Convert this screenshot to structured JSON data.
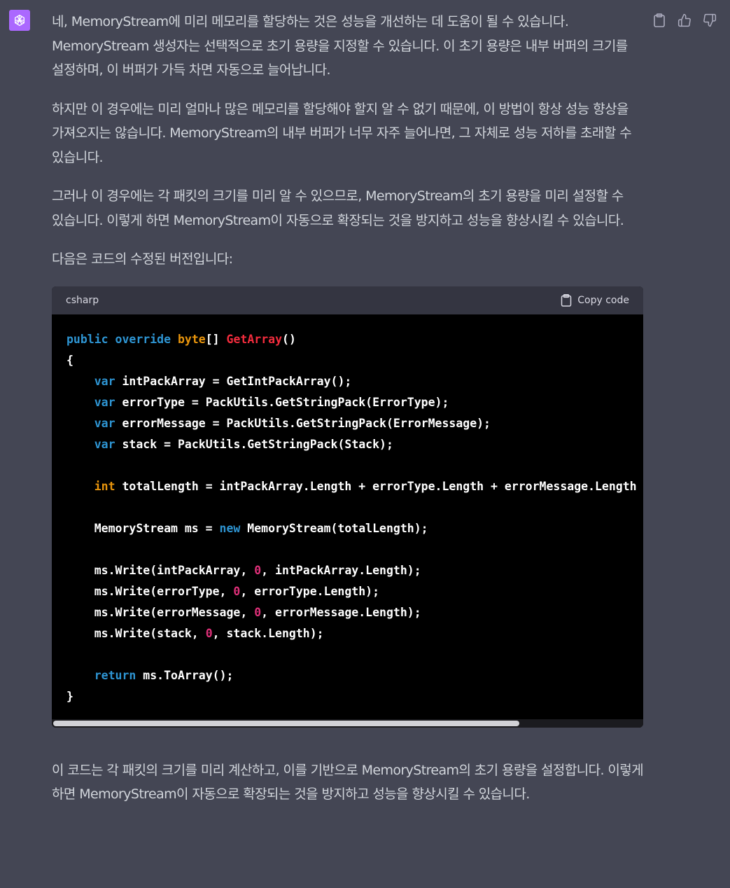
{
  "message": {
    "paragraphs": [
      "네, MemoryStream에 미리 메모리를 할당하는 것은 성능을 개선하는 데 도움이 될 수 있습니다. MemoryStream 생성자는 선택적으로 초기 용량을 지정할 수 있습니다. 이 초기 용량은 내부 버퍼의 크기를 설정하며, 이 버퍼가 가득 차면 자동으로 늘어납니다.",
      "하지만 이 경우에는 미리 얼마나 많은 메모리를 할당해야 할지 알 수 없기 때문에, 이 방법이 항상 성능 향상을 가져오지는 않습니다. MemoryStream의 내부 버퍼가 너무 자주 늘어나면, 그 자체로 성능 저하를 초래할 수 있습니다.",
      "그러나 이 경우에는 각 패킷의 크기를 미리 알 수 있으므로, MemoryStream의 초기 용량을 미리 설정할 수 있습니다. 이렇게 하면 MemoryStream이 자동으로 확장되는 것을 방지하고 성능을 향상시킬 수 있습니다.",
      "다음은 코드의 수정된 버전입니다:"
    ],
    "after": "이 코드는 각 패킷의 크기를 미리 계산하고, 이를 기반으로 MemoryStream의 초기 용량을 설정합니다. 이렇게 하면 MemoryStream이 자동으로 확장되는 것을 방지하고 성능을 향상시킬 수 있습니다."
  },
  "code": {
    "language": "csharp",
    "copy_label": "Copy code",
    "lines": [
      [
        {
          "t": "public",
          "c": "kw"
        },
        {
          "t": " "
        },
        {
          "t": "override",
          "c": "kw"
        },
        {
          "t": " "
        },
        {
          "t": "byte",
          "c": "ct"
        },
        {
          "t": "[] "
        },
        {
          "t": "GetArray",
          "c": "ty"
        },
        {
          "t": "()"
        }
      ],
      [
        {
          "t": "{"
        }
      ],
      [
        {
          "t": "    "
        },
        {
          "t": "var",
          "c": "kw"
        },
        {
          "t": " intPackArray = GetIntPackArray();"
        }
      ],
      [
        {
          "t": "    "
        },
        {
          "t": "var",
          "c": "kw"
        },
        {
          "t": " errorType = PackUtils.GetStringPack(ErrorType);"
        }
      ],
      [
        {
          "t": "    "
        },
        {
          "t": "var",
          "c": "kw"
        },
        {
          "t": " errorMessage = PackUtils.GetStringPack(ErrorMessage);"
        }
      ],
      [
        {
          "t": "    "
        },
        {
          "t": "var",
          "c": "kw"
        },
        {
          "t": " stack = PackUtils.GetStringPack(Stack);"
        }
      ],
      [],
      [
        {
          "t": "    "
        },
        {
          "t": "int",
          "c": "ct"
        },
        {
          "t": " totalLength = intPackArray.Length + errorType.Length + errorMessage.Length + stack.Length;"
        }
      ],
      [],
      [
        {
          "t": "    MemoryStream ms = "
        },
        {
          "t": "new",
          "c": "kw"
        },
        {
          "t": " MemoryStream(totalLength);"
        }
      ],
      [],
      [
        {
          "t": "    ms.Write(intPackArray, "
        },
        {
          "t": "0",
          "c": "or"
        },
        {
          "t": ", intPackArray.Length);"
        }
      ],
      [
        {
          "t": "    ms.Write(errorType, "
        },
        {
          "t": "0",
          "c": "or"
        },
        {
          "t": ", errorType.Length);"
        }
      ],
      [
        {
          "t": "    ms.Write(errorMessage, "
        },
        {
          "t": "0",
          "c": "or"
        },
        {
          "t": ", errorMessage.Length);"
        }
      ],
      [
        {
          "t": "    ms.Write(stack, "
        },
        {
          "t": "0",
          "c": "or"
        },
        {
          "t": ", stack.Length);"
        }
      ],
      [],
      [
        {
          "t": "    "
        },
        {
          "t": "return",
          "c": "kw"
        },
        {
          "t": " ms.ToArray();"
        }
      ],
      [
        {
          "t": "}"
        }
      ]
    ]
  },
  "colors": {
    "background": "#444654",
    "text": "#d1d5db",
    "avatar": "#ab68ff",
    "code_background": "#000000",
    "code_header": "#343541",
    "keyword": "#2e95d3",
    "method": "#f22c3d",
    "number": "#df3079",
    "type": "#e9950c"
  },
  "icons": {
    "avatar": "openai-logo-icon",
    "copy": "clipboard-icon",
    "like": "thumbs-up-icon",
    "dislike": "thumbs-down-icon"
  }
}
